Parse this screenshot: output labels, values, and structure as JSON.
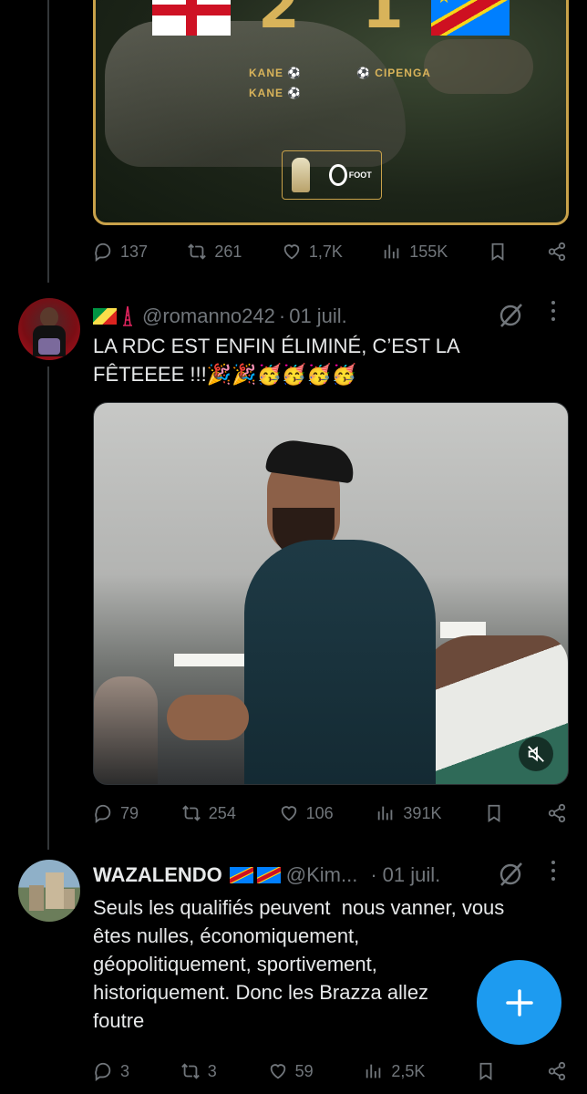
{
  "tweet_top": {
    "scoreboard": {
      "home_score": "2",
      "away_score": "1",
      "home_scorers": [
        "KANE",
        "KANE"
      ],
      "away_scorers": [
        "CIPENGA"
      ],
      "sponsor": "FOOT"
    },
    "stats": {
      "replies": "137",
      "reposts": "261",
      "likes": "1,7K",
      "views": "155K"
    }
  },
  "tweet_romanno": {
    "handle": "@romanno242",
    "separator": "·",
    "date": "01 juil.",
    "text_line1": "LA RDC EST ENFIN ÉLIMINÉ, C’EST LA",
    "text_line2": "FÊTEEEE !!!🎉🎉🥳🥳🥳🥳",
    "stats": {
      "replies": "79",
      "reposts": "254",
      "likes": "106",
      "views": "391K"
    }
  },
  "tweet_wazalendo": {
    "name": "WAZALENDO",
    "handle": "@Kim...",
    "separator": "·",
    "date": "01 juil.",
    "text_lines": [
      "Seuls les qualifiés peuvent  nous vanner, vous",
      "êtes nulles, économiquement,",
      "géopolitiquement, sportivement,",
      "historiquement. Donc les Brazza allez",
      "foutre"
    ],
    "stats": {
      "replies": "3",
      "reposts": "3",
      "likes": "59",
      "views": "2,5K"
    }
  },
  "colors": {
    "accent": "#1d9bf0",
    "muted": "#71767b",
    "gold_border": "#c9a24a"
  },
  "icons": [
    "reply-icon",
    "repost-icon",
    "like-icon",
    "views-icon",
    "bookmark-icon",
    "share-icon",
    "grok-icon",
    "more-icon",
    "compose-plus-icon",
    "mute-icon"
  ]
}
